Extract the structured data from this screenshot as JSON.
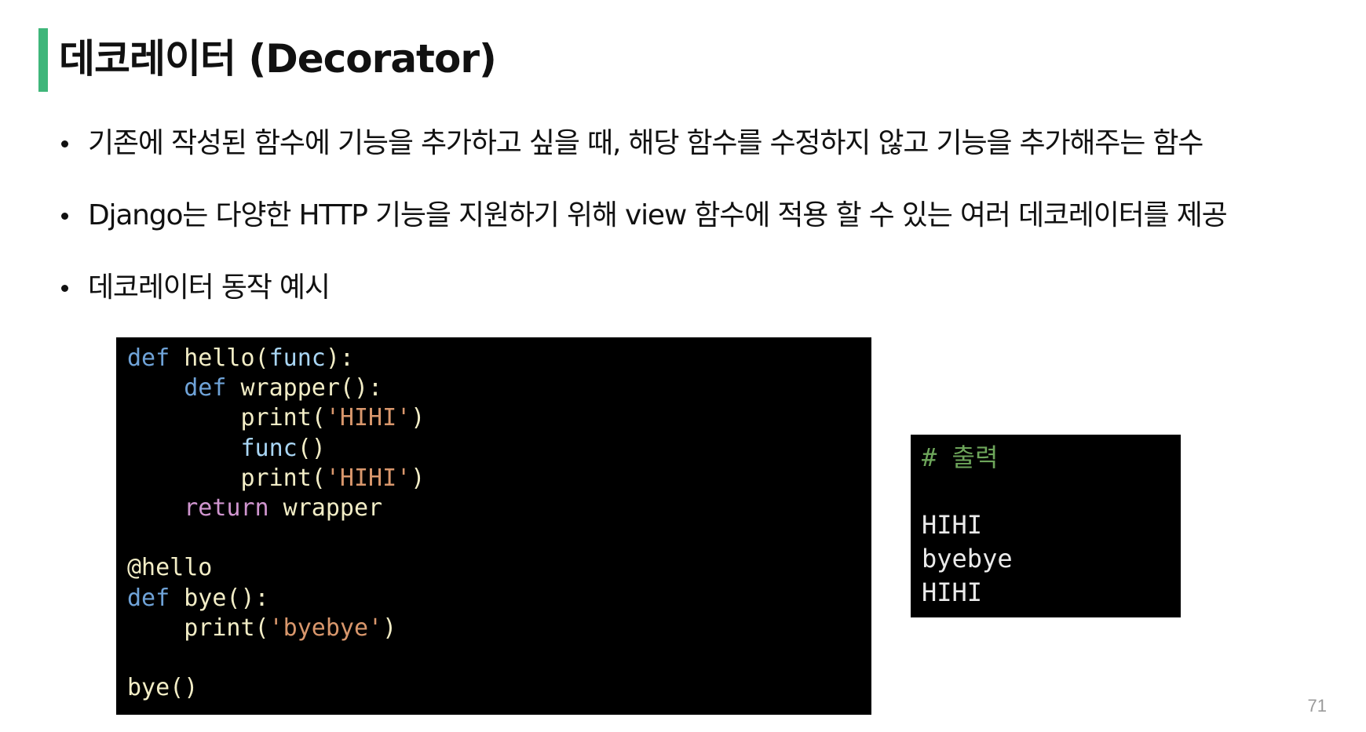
{
  "slide": {
    "title": "데코레이터 (Decorator)",
    "bullets": [
      "기존에 작성된 함수에 기능을 추가하고 싶을 때, 해당 함수를 수정하지 않고 기능을 추가해주는 함수",
      "Django는 다양한 HTTP 기능을 지원하기 위해 view 함수에 적용 할 수 있는 여러 데코레이터를 제공",
      "데코레이터 동작 예시"
    ],
    "page_number": "71"
  },
  "code": {
    "kw_def": "def",
    "kw_return": "return",
    "hello_sig": " hello(",
    "param_func": "func",
    "hello_end": "):",
    "indent1": "    ",
    "indent2": "        ",
    "wrapper_sig": " wrapper():",
    "print_open": "print(",
    "str_hihi": "'HIHI'",
    "paren_close": ")",
    "func_name": "func",
    "call_parens": "()",
    "return_wrapper": " wrapper",
    "decorator": "@hello",
    "bye_sig": " bye():",
    "str_byebye": "'byebye'",
    "bye_call": "bye()"
  },
  "output": {
    "comment": "# 출력",
    "lines": [
      "HIHI",
      "byebye",
      "HIHI"
    ]
  },
  "colors": {
    "accent": "#3fb67a",
    "keyword": "#6fa3d8",
    "return_keyword": "#d095cf",
    "string": "#d9976c",
    "param": "#a9d6f5",
    "comment": "#6da55a"
  }
}
